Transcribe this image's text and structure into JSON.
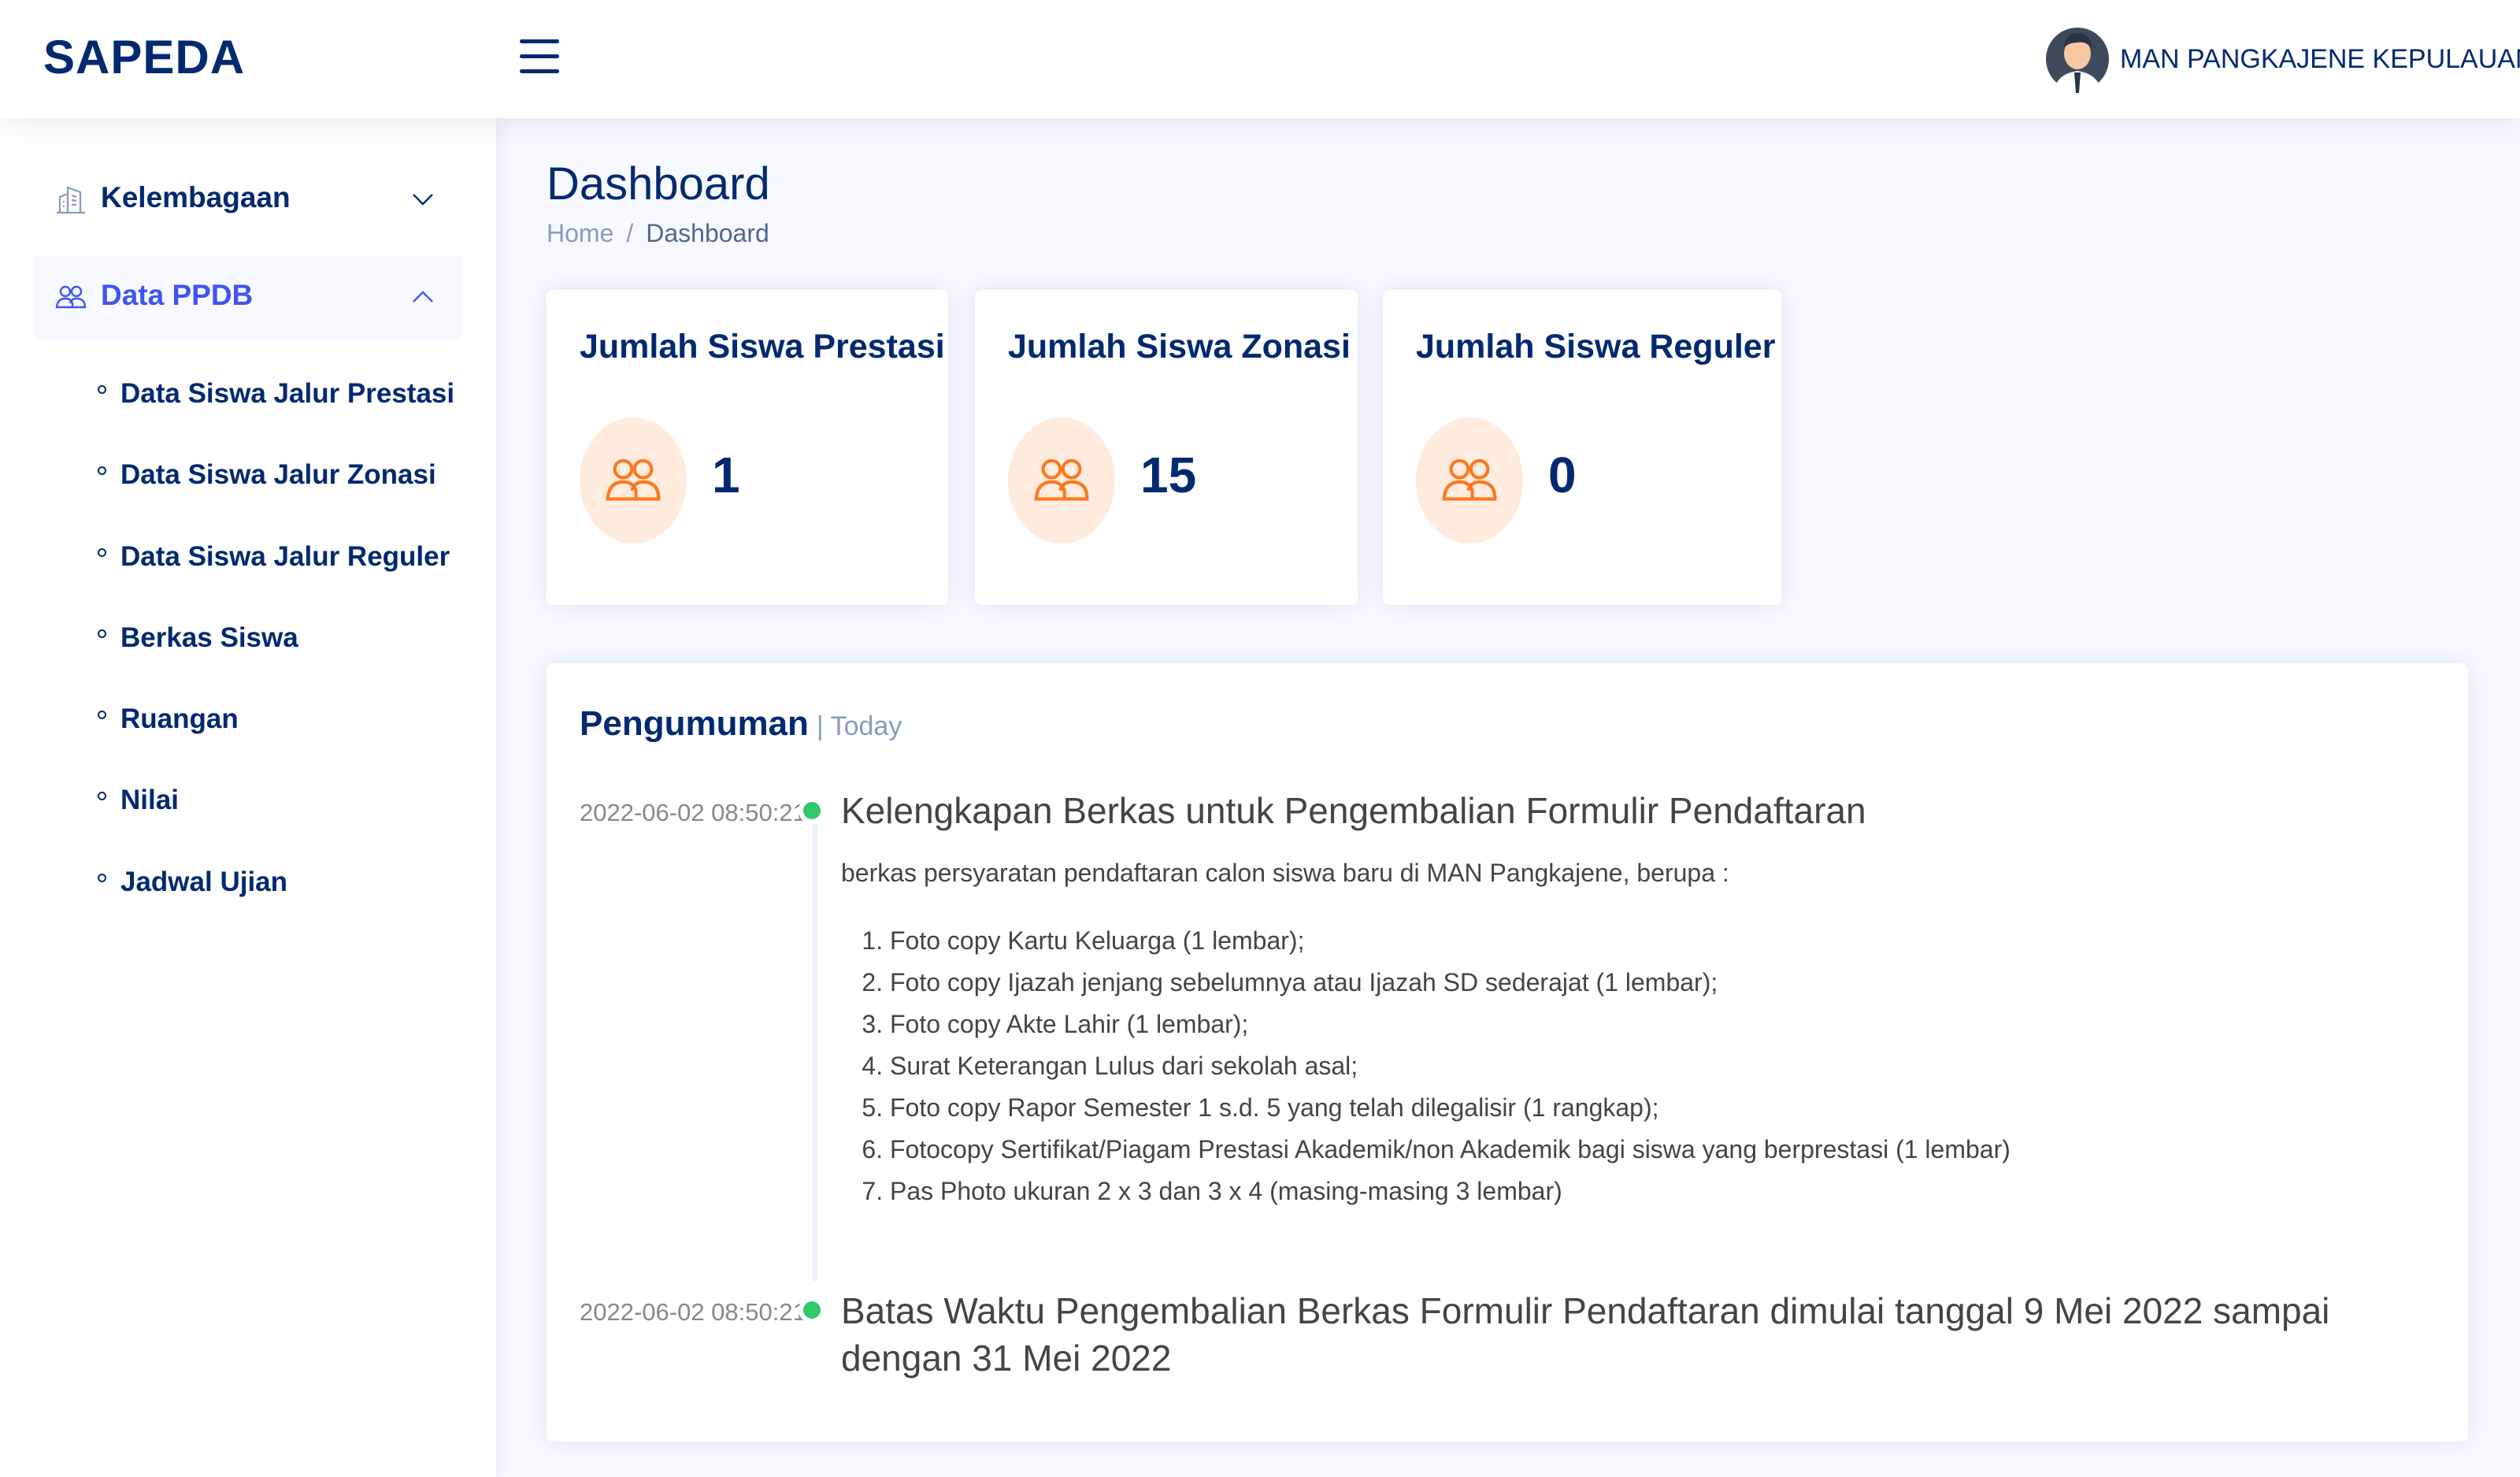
{
  "header": {
    "brand": "SAPEDA",
    "profile_name": "MAN PANGKAJENE KEPULAUAN"
  },
  "sidebar": {
    "items": [
      {
        "label": "Kelembagaan",
        "icon": "building-icon",
        "expanded": false
      },
      {
        "label": "Data PPDB",
        "icon": "users-icon",
        "expanded": true
      }
    ],
    "subitems": [
      "Data Siswa Jalur Prestasi",
      "Data Siswa Jalur Zonasi",
      "Data Siswa Jalur Reguler",
      "Berkas Siswa",
      "Ruangan",
      "Nilai",
      "Jadwal Ujian"
    ]
  },
  "page": {
    "title": "Dashboard",
    "breadcrumb": {
      "home": "Home",
      "separator": "/",
      "current": "Dashboard"
    }
  },
  "cards": [
    {
      "title": "Jumlah Siswa Prestasi",
      "value": "1"
    },
    {
      "title": "Jumlah Siswa Zonasi",
      "value": "15"
    },
    {
      "title": "Jumlah Siswa Reguler",
      "value": "0"
    }
  ],
  "announcements": {
    "title": "Pengumuman",
    "subtitle": "| Today",
    "items": [
      {
        "time": "2022-06-02 08:50:21",
        "heading": "Kelengkapan Berkas untuk Pengembalian Formulir Pendaftaran",
        "body": "berkas persyaratan pendaftaran calon siswa baru di MAN Pangkajene, berupa :",
        "list": [
          "Foto copy Kartu Keluarga (1 lembar);",
          "Foto copy Ijazah jenjang sebelumnya atau Ijazah SD sederajat (1 lembar);",
          "Foto copy Akte Lahir (1 lembar);",
          "Surat Keterangan Lulus dari sekolah asal;",
          "Foto copy Rapor Semester 1 s.d. 5 yang telah dilegalisir (1 rangkap);",
          "Fotocopy Sertifikat/Piagam Prestasi Akademik/non Akademik bagi siswa yang berprestasi (1 lembar)",
          "Pas Photo ukuran 2 x 3 dan 3 x 4 (masing-masing 3 lembar)"
        ]
      },
      {
        "time": "2022-06-02 08:50:21",
        "heading": "Batas Waktu Pengembalian Berkas Formulir Pendaftaran dimulai tanggal 9 Mei 2022 sampai dengan 31 Mei 2022"
      }
    ]
  },
  "colors": {
    "primary": "#012970",
    "accent": "#4154f1",
    "icon_orange": "#ff771d",
    "icon_bg": "#ffecdf",
    "timeline_dot": "#2eca6a",
    "page_bg": "#f6f9ff"
  }
}
